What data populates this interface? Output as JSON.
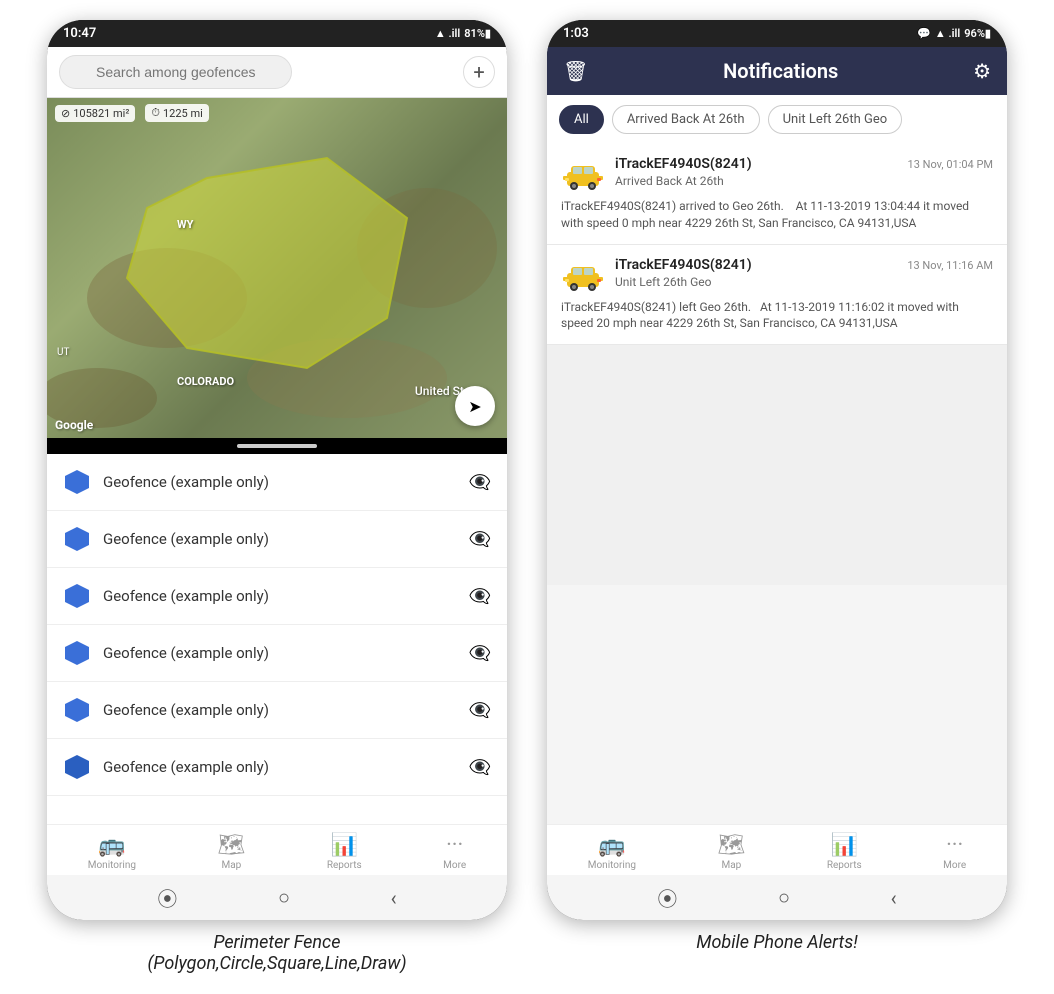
{
  "page": {
    "divider": "·"
  },
  "phone1": {
    "status_time": "10:47",
    "status_icons": "▲ .ill 81%▮",
    "search_placeholder": "Search among geofences",
    "map_stat1": "⊘ 105821 mi²",
    "map_stat2": "⏱ 1225 mi",
    "map_label": "United States",
    "map_wy": "WY",
    "map_ut": "UT",
    "map_colorado": "COLORADO",
    "google_logo": "Google",
    "geofence_items": [
      {
        "name": "Geofence (example only)"
      },
      {
        "name": "Geofence (example only)"
      },
      {
        "name": "Geofence (example only)"
      },
      {
        "name": "Geofence (example only)"
      },
      {
        "name": "Geofence (example only)"
      },
      {
        "name": "Geofence (example only)"
      }
    ],
    "nav_items": [
      {
        "icon": "🚌",
        "label": "Monitoring"
      },
      {
        "icon": "🗺",
        "label": "Map"
      },
      {
        "icon": "📊",
        "label": "Reports"
      },
      {
        "icon": "···",
        "label": "More"
      }
    ],
    "caption": "Perimeter Fence\n(Polygon,Circle,Square,Line,Draw)"
  },
  "phone2": {
    "status_time": "1:03",
    "status_icons": "💬 ▲ .ill 96%▮",
    "header_title": "Notifications",
    "tabs": [
      {
        "label": "All",
        "active": true
      },
      {
        "label": "Arrived Back At 26th",
        "active": false
      },
      {
        "label": "Unit Left 26th Geo",
        "active": false
      }
    ],
    "notifications": [
      {
        "device": "iTrackEF4940S(8241)",
        "timestamp": "13 Nov, 01:04 PM",
        "event": "Arrived Back At 26th",
        "body": "iTrackEF4940S(8241) arrived to Geo 26th.    At 11-13-2019 13:04:44 it moved with speed 0 mph near 4229 26th St, San Francisco, CA 94131,USA"
      },
      {
        "device": "iTrackEF4940S(8241)",
        "timestamp": "13 Nov, 11:16 AM",
        "event": "Unit Left 26th Geo",
        "body": "iTrackEF4940S(8241) left Geo 26th.   At 11-13-2019 11:16:02 it moved with speed 20 mph near 4229 26th St, San Francisco, CA 94131,USA"
      }
    ],
    "nav_items": [
      {
        "icon": "🚌",
        "label": "Monitoring"
      },
      {
        "icon": "🗺",
        "label": "Map"
      },
      {
        "icon": "📊",
        "label": "Reports"
      },
      {
        "icon": "···",
        "label": "More"
      }
    ],
    "caption": "Mobile Phone Alerts!"
  }
}
